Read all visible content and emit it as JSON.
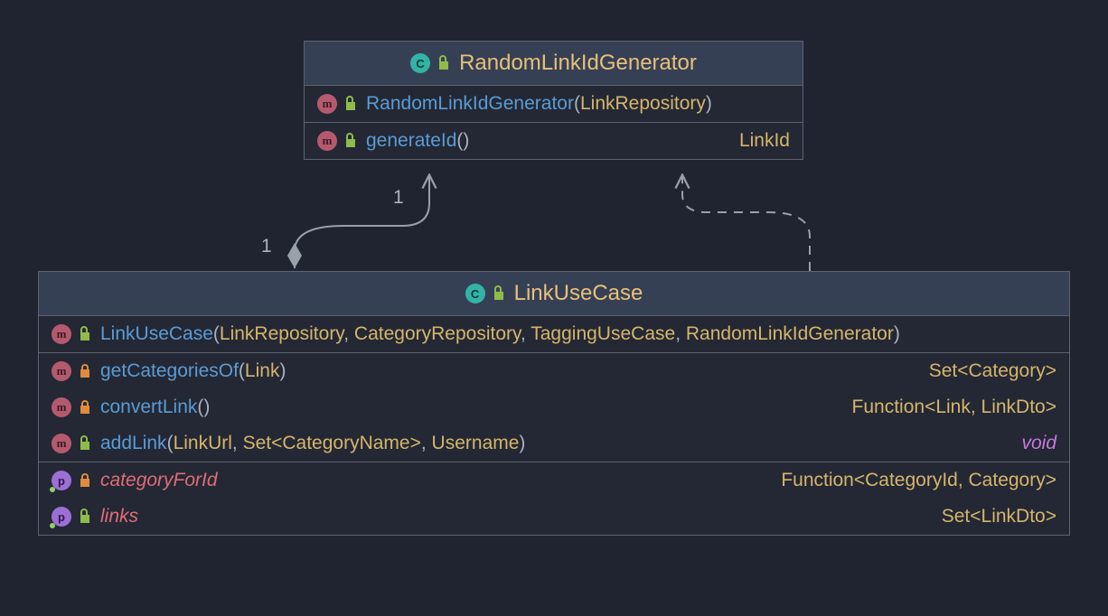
{
  "top_class": {
    "name": "RandomLinkIdGenerator",
    "members": [
      {
        "badge": "m",
        "viz": "public",
        "method": "RandomLinkIdGenerator",
        "params": [
          {
            "t": "LinkRepository"
          }
        ],
        "ret": null
      },
      {
        "badge": "m",
        "viz": "public",
        "method": "generateId",
        "params": [],
        "ret": "LinkId"
      }
    ]
  },
  "bottom_class": {
    "name": "LinkUseCase",
    "sections": [
      [
        {
          "badge": "m",
          "viz": "public",
          "method": "LinkUseCase",
          "params": [
            {
              "t": "LinkRepository"
            },
            {
              "t": "CategoryRepository"
            },
            {
              "t": "TaggingUseCase",
              "comma": true
            },
            {
              "t": "RandomLinkIdGenerator"
            }
          ],
          "ret": null
        }
      ],
      [
        {
          "badge": "m",
          "viz": "private",
          "method": "getCategoriesOf",
          "params": [
            {
              "t": "Link"
            }
          ],
          "ret": "Set<Category>"
        },
        {
          "badge": "m",
          "viz": "private",
          "method": "convertLink",
          "params": [],
          "ret": "Function<Link, LinkDto>"
        },
        {
          "badge": "m",
          "viz": "public",
          "method": "addLink",
          "params": [
            {
              "t": "LinkUrl",
              "comma": true
            },
            {
              "t": "Set<CategoryName>",
              "comma": true
            },
            {
              "t": "Username"
            }
          ],
          "ret_void": "void"
        }
      ],
      [
        {
          "badge": "p",
          "viz": "private",
          "prop": "categoryForId",
          "ret": "Function<CategoryId, Category>"
        },
        {
          "badge": "p",
          "viz": "public",
          "prop": "links",
          "ret": "Set<LinkDto>"
        }
      ]
    ]
  },
  "labels": {
    "mult_top": "1",
    "mult_bottom": "1"
  }
}
